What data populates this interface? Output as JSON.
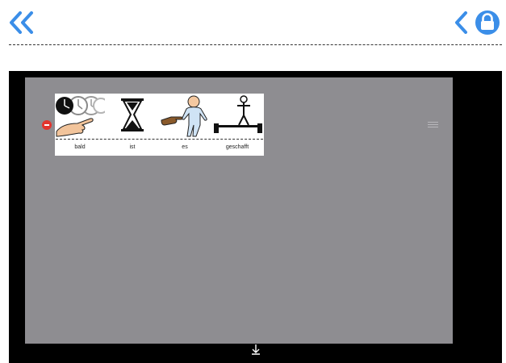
{
  "toolbar": {
    "icons": [
      "double-chevron-left-icon",
      "chevron-left-icon",
      "lock-icon"
    ],
    "accent_color": "#3b8ee8"
  },
  "sentence": {
    "words": [
      {
        "label": "bald",
        "icon": "clock-pointing-icon"
      },
      {
        "label": "ist",
        "icon": "hourglass-icon"
      },
      {
        "label": "es",
        "icon": "pointing-baby-icon"
      },
      {
        "label": "geschafft",
        "icon": "balance-beam-icon"
      }
    ]
  },
  "colors": {
    "canvas": "#8e8d91",
    "remove": "#e2352e",
    "background": "#000000"
  }
}
